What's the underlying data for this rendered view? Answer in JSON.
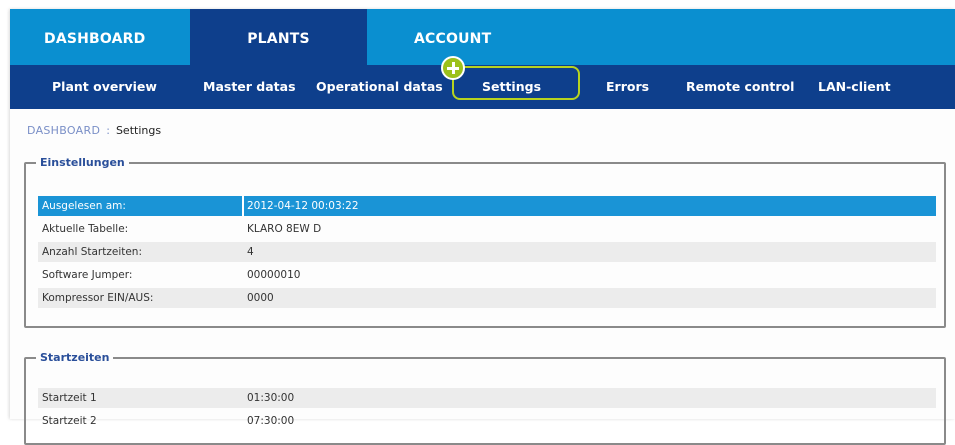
{
  "topnav": {
    "dashboard": "DASHBOARD",
    "plants": "PLANTS",
    "account": "ACCOUNT"
  },
  "subnav": {
    "plant_overview": "Plant overview",
    "master_datas": "Master datas",
    "operational_datas": "Operational datas",
    "settings": "Settings",
    "errors": "Errors",
    "remote_control": "Remote control",
    "lan_client": "LAN-client"
  },
  "breadcrumb": {
    "root": "DASHBOARD",
    "separator": ":",
    "current": "Settings"
  },
  "einstellungen": {
    "legend": "Einstellungen",
    "rows": [
      {
        "label": "Ausgelesen am:",
        "value": "2012-04-12 00:03:22"
      },
      {
        "label": "Aktuelle Tabelle:",
        "value": "KLARO 8EW D"
      },
      {
        "label": "Anzahl Startzeiten:",
        "value": "4"
      },
      {
        "label": "Software Jumper:",
        "value": "00000010"
      },
      {
        "label": "Kompressor EIN/AUS:",
        "value": "0000"
      }
    ]
  },
  "startzeiten": {
    "legend": "Startzeiten",
    "rows": [
      {
        "label": "Startzeit 1",
        "value": "01:30:00"
      },
      {
        "label": "Startzeit 2",
        "value": "07:30:00"
      }
    ]
  },
  "colors": {
    "topnav_bg": "#0a8fd0",
    "active_tab_bg": "#0e3f8c",
    "highlight": "#b7d320",
    "selected_row": "#1a94d6"
  }
}
